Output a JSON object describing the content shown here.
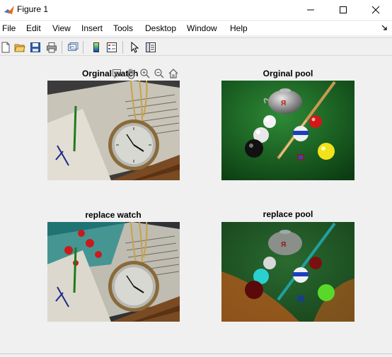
{
  "window": {
    "title": "Figure 1"
  },
  "menu": [
    "File",
    "Edit",
    "View",
    "Insert",
    "Tools",
    "Desktop",
    "Window",
    "Help"
  ],
  "axes": [
    {
      "title": "Orginal watch"
    },
    {
      "title": "Orginal pool"
    },
    {
      "title": "replace watch"
    },
    {
      "title": "replace pool"
    }
  ],
  "axes_toolbar_icons": [
    "data-tips-icon",
    "pan-hand-icon",
    "zoom-in-icon",
    "zoom-out-icon",
    "home-icon"
  ],
  "toolbar_icons": [
    "new-figure-icon",
    "open-file-icon",
    "save-icon",
    "print-icon",
    "link-plot-icon",
    "colorbar-icon",
    "legend-icon",
    "edit-plot-arrow-icon",
    "property-inspector-icon"
  ],
  "colors": {
    "matlab_orange": "#e66c1e",
    "felt_green": "#0f5a1c",
    "wood_brown": "#7a4a22"
  }
}
